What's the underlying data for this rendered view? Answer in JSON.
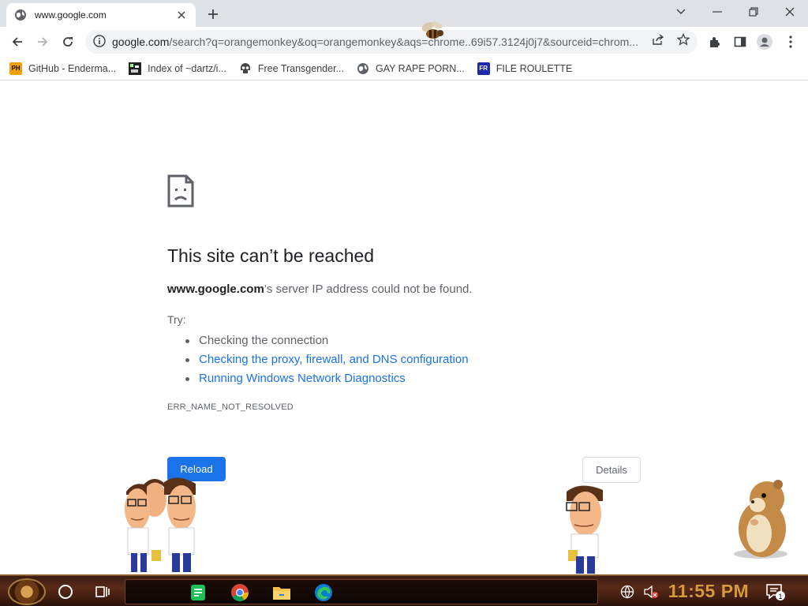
{
  "browser": {
    "tab": {
      "title": "www.google.com",
      "favicon": "globe-icon"
    },
    "new_tab": "new-tab-icon",
    "window_controls": [
      "chevron-down-icon",
      "minimize-icon",
      "restore-icon",
      "close-icon"
    ]
  },
  "toolbar": {
    "url_host": "google.com",
    "url_rest": "/search?q=orangemonkey&oq=orangemonkey&aqs=chrome..69i57.3124j0j7&sourceid=chrom...",
    "icons": [
      "back-icon",
      "forward-icon",
      "reload-icon",
      "info-icon",
      "share-icon",
      "star-icon",
      "extensions-icon",
      "side-panel-icon",
      "profile-icon",
      "menu-icon"
    ]
  },
  "bookmarks": [
    {
      "label": "GitHub - Enderma...",
      "icon": "PH",
      "color": "#f0a000"
    },
    {
      "label": "Index of ~dartz/i...",
      "icon": "PX",
      "color": "#222222"
    },
    {
      "label": "Free Transgender...",
      "icon": "skull",
      "color": "#444444"
    },
    {
      "label": "GAY RAPE PORN...",
      "icon": "globe",
      "color": "#5f6368"
    },
    {
      "label": "FILE ROULETTE",
      "icon": "FR",
      "color": "#1a2aa8"
    }
  ],
  "error": {
    "title": "This site can’t be reached",
    "host": "www.google.com",
    "message": "’s server IP address could not be found.",
    "try": "Try:",
    "suggestions": [
      "Checking the connection",
      "Checking the proxy, firewall, and DNS configuration",
      "Running Windows Network Diagnostics"
    ],
    "code": "ERR_NAME_NOT_RESOLVED",
    "reload": "Reload",
    "details": "Details"
  },
  "taskbar": {
    "clock": "11:55 PM",
    "apps": [
      "notes-app-icon",
      "chrome-icon",
      "file-explorer-icon",
      "edge-icon"
    ],
    "tray": [
      "network-icon",
      "muted-speaker-icon"
    ],
    "notification_count": "1"
  },
  "colors": {
    "accent": "#1a73e8",
    "tab_strip": "#dee1e6",
    "clock": "#d69a3a"
  }
}
